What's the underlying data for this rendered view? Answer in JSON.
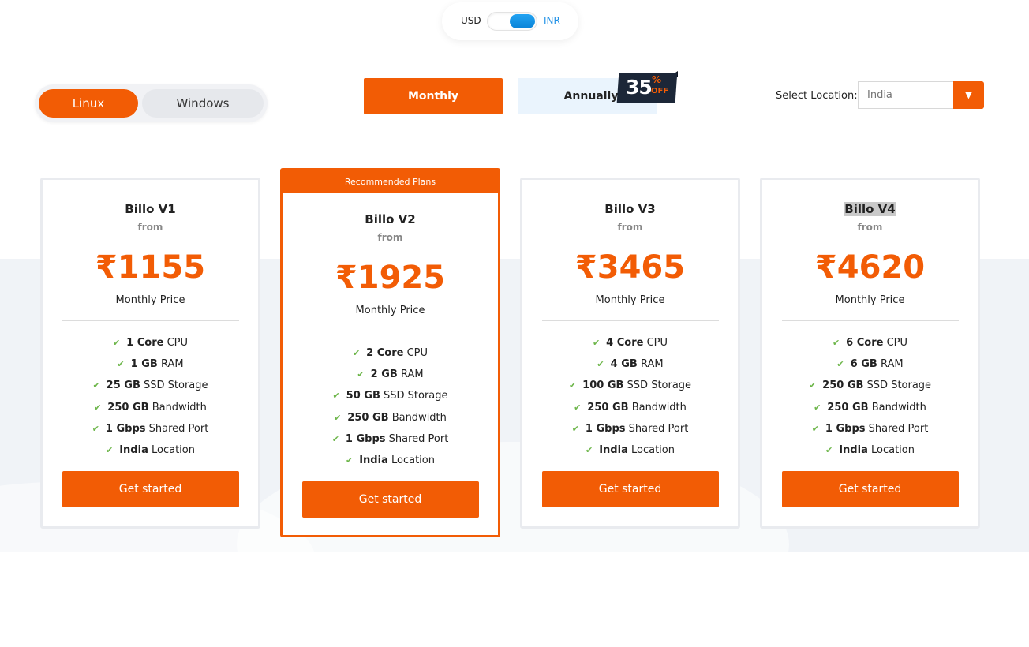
{
  "currency": {
    "left": "USD",
    "right": "INR",
    "selected": "INR"
  },
  "os": {
    "linux": "Linux",
    "windows": "Windows",
    "selected": "Linux"
  },
  "billing": {
    "monthly": "Monthly",
    "annually": "Annually",
    "selected": "Monthly",
    "discount_number": "35",
    "discount_percent": "%",
    "discount_off": "OFF"
  },
  "location": {
    "label": "Select Location:",
    "placeholder": "India"
  },
  "recommended_label": "Recommended Plans",
  "plans": [
    {
      "name": "Billo V1",
      "from": "from",
      "price": "₹1155",
      "price_label": "Monthly Price",
      "features": [
        {
          "value": "1 Core",
          "label": "CPU"
        },
        {
          "value": "1 GB",
          "label": "RAM"
        },
        {
          "value": "25 GB",
          "label": "SSD Storage"
        },
        {
          "value": "250 GB",
          "label": "Bandwidth"
        },
        {
          "value": "1 Gbps",
          "label": "Shared Port"
        },
        {
          "value": "India",
          "label": "Location"
        }
      ],
      "cta": "Get started"
    },
    {
      "name": "Billo V2",
      "from": "from",
      "price": "₹1925",
      "price_label": "Monthly Price",
      "features": [
        {
          "value": "2 Core",
          "label": "CPU"
        },
        {
          "value": "2 GB",
          "label": "RAM"
        },
        {
          "value": "50 GB",
          "label": "SSD Storage"
        },
        {
          "value": "250 GB",
          "label": "Bandwidth"
        },
        {
          "value": "1 Gbps",
          "label": "Shared Port"
        },
        {
          "value": "India",
          "label": "Location"
        }
      ],
      "cta": "Get started"
    },
    {
      "name": "Billo V3",
      "from": "from",
      "price": "₹3465",
      "price_label": "Monthly Price",
      "features": [
        {
          "value": "4 Core",
          "label": "CPU"
        },
        {
          "value": "4 GB",
          "label": "RAM"
        },
        {
          "value": "100 GB",
          "label": "SSD Storage"
        },
        {
          "value": "250 GB",
          "label": "Bandwidth"
        },
        {
          "value": "1 Gbps",
          "label": "Shared Port"
        },
        {
          "value": "India",
          "label": "Location"
        }
      ],
      "cta": "Get started"
    },
    {
      "name": "Billo V4",
      "from": "from",
      "price": "₹4620",
      "price_label": "Monthly Price",
      "features": [
        {
          "value": "6 Core",
          "label": "CPU"
        },
        {
          "value": "6 GB",
          "label": "RAM"
        },
        {
          "value": "250 GB",
          "label": "SSD Storage"
        },
        {
          "value": "250 GB",
          "label": "Bandwidth"
        },
        {
          "value": "1 Gbps",
          "label": "Shared Port"
        },
        {
          "value": "India",
          "label": "Location"
        }
      ],
      "cta": "Get started"
    }
  ],
  "colors": {
    "accent": "#f25c05",
    "toggle_blue": "#1e90e6",
    "check_green": "#6db64a",
    "badge_dark": "#1c2738"
  },
  "icons": {
    "check": "check-icon",
    "dropdown": "caret-down-icon"
  }
}
